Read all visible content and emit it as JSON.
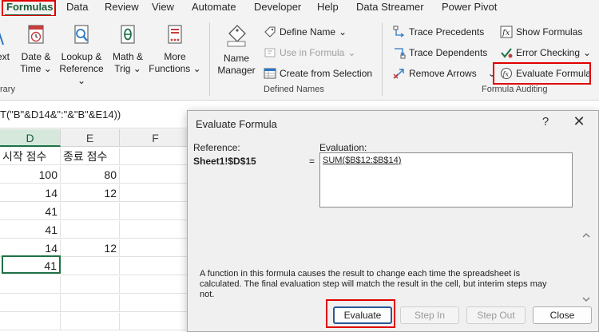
{
  "tabs": [
    "Formulas",
    "Data",
    "Review",
    "View",
    "Automate",
    "Developer",
    "Help",
    "Data Streamer",
    "Power Pivot"
  ],
  "ribbon": {
    "text_btn": "ext",
    "date_time": [
      "Date &",
      "Time"
    ],
    "lookup_ref": [
      "Lookup &",
      "Reference"
    ],
    "math_trig": [
      "Math &",
      "Trig"
    ],
    "more_functions": [
      "More",
      "Functions"
    ],
    "library_label": "rary",
    "name_manager": [
      "Name",
      "Manager"
    ],
    "define_name": "Define Name",
    "use_in_formula": "Use in Formula",
    "create_from_selection": "Create from Selection",
    "defined_names_label": "Defined Names",
    "trace_precedents": "Trace Precedents",
    "trace_dependents": "Trace Dependents",
    "remove_arrows": "Remove Arrows",
    "show_formulas": "Show Formulas",
    "error_checking": "Error Checking",
    "evaluate_formula": "Evaluate Formula",
    "formula_auditing_label": "Formula Auditing"
  },
  "formula_bar": {
    "text": "T(\"B\"&D14&\":\"&\"B\"&E14))"
  },
  "sheet": {
    "columns": [
      "D",
      "E",
      "F"
    ],
    "header_row": [
      "시작 점수",
      "종료 점수",
      ""
    ],
    "rows": [
      [
        "100",
        "80",
        ""
      ],
      [
        "14",
        "12",
        ""
      ],
      [
        "41",
        "",
        ""
      ],
      [
        "41",
        "",
        ""
      ],
      [
        "14",
        "12",
        ""
      ],
      [
        "41",
        "",
        ""
      ]
    ]
  },
  "dialog": {
    "title": "Evaluate Formula",
    "help": "?",
    "close": "✕",
    "reference_label": "Reference:",
    "reference_value": "Sheet1!$D$15",
    "equals": "=",
    "evaluation_label": "Evaluation:",
    "evaluation_value": "SUM($B$12:$B$14)",
    "info": "A function in this formula causes the result to change each time the spreadsheet is calculated.  The final evaluation step will match the result in the cell, but interim steps may not.",
    "buttons": {
      "evaluate": "Evaluate",
      "step_in": "Step In",
      "step_out": "Step Out",
      "close": "Close"
    }
  },
  "colors": {
    "accent": "#185c37",
    "highlight": "#e00000",
    "selection": "#1e7145"
  }
}
